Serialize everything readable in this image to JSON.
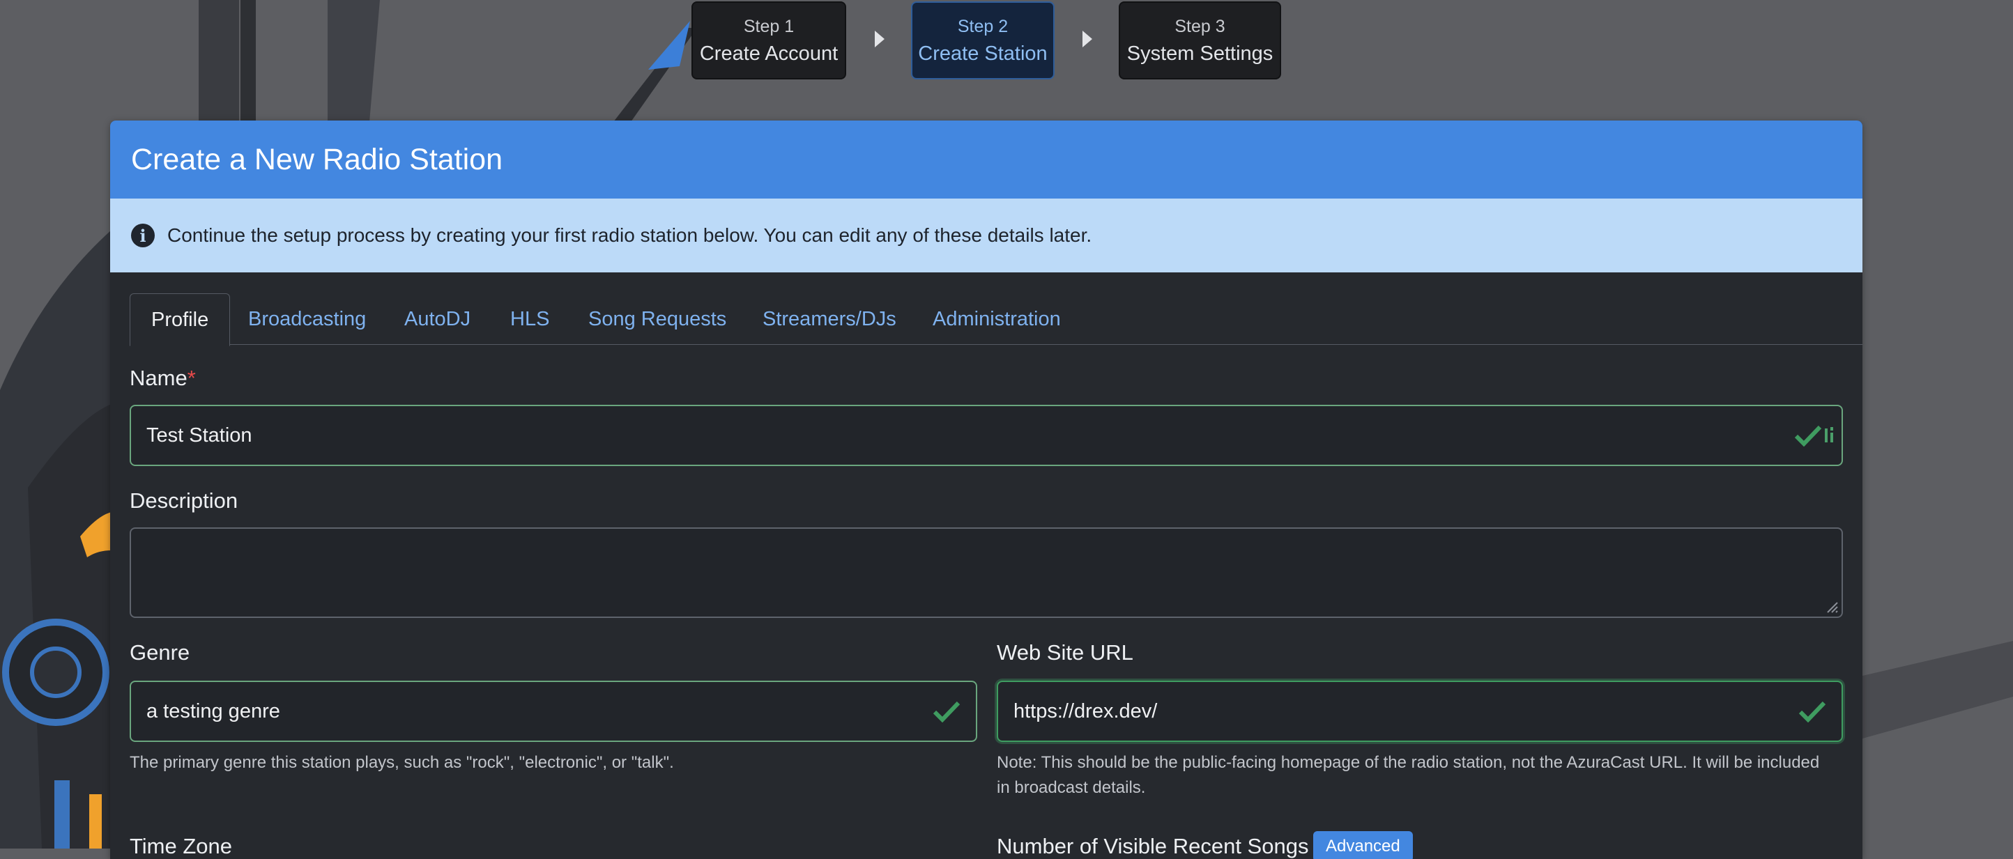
{
  "stepper": {
    "steps": [
      {
        "number": "Step 1",
        "title": "Create Account",
        "active": false
      },
      {
        "number": "Step 2",
        "title": "Create Station",
        "active": true
      },
      {
        "number": "Step 3",
        "title": "System Settings",
        "active": false
      }
    ]
  },
  "card": {
    "title": "Create a New Radio Station",
    "alert": {
      "icon": "info-icon",
      "text": "Continue the setup process by creating your first radio station below. You can edit any of these details later."
    }
  },
  "tabs": [
    "Profile",
    "Broadcasting",
    "AutoDJ",
    "HLS",
    "Song Requests",
    "Streamers/DJs",
    "Administration"
  ],
  "active_tab": "Profile",
  "form": {
    "name": {
      "label": "Name",
      "required_mark": "*",
      "value": "Test Station"
    },
    "description": {
      "label": "Description",
      "value": ""
    },
    "genre": {
      "label": "Genre",
      "value": "a testing genre",
      "help": "The primary genre this station plays, such as \"rock\", \"electronic\", or \"talk\"."
    },
    "website_url": {
      "label": "Web Site URL",
      "value": "https://drex.dev/",
      "help_line1": "Note: This should be the public-facing homepage of the radio station, not the AzuraCast URL. It will be included",
      "help_line2": "in broadcast details."
    },
    "time_zone": {
      "label": "Time Zone"
    },
    "recent_songs": {
      "label": "Number of Visible Recent Songs",
      "badge": "Advanced"
    }
  },
  "colors": {
    "header": "#4387e0",
    "alert_bg": "#bcdaf8",
    "valid": "#3f9c60",
    "link": "#7fb2ef",
    "card_bg": "#26292e"
  }
}
